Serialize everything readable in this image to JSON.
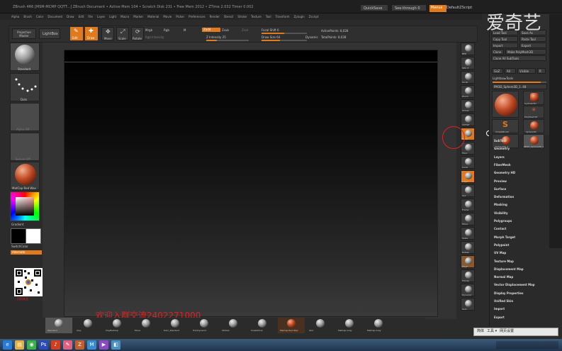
{
  "title_bar": {
    "app_info": "ZBrush 4R6 [MSM-MCMP QQTT...] ZBrush Document • Active Mem 104 • Scratch Disk 231 • Free Mem 2012 • ZTime 2.032 Timer 0.002",
    "quicksave": "QuickSave",
    "see_through": "See-through 0",
    "menus_btn": "Menus",
    "default_script": "DefaultZScript"
  },
  "menubar": {
    "items": [
      "Alpha",
      "Brush",
      "Color",
      "Document",
      "Draw",
      "Edit",
      "File",
      "Layer",
      "Light",
      "Macro",
      "Marker",
      "Material",
      "Movie",
      "Picker",
      "Preferences",
      "Render",
      "Stencil",
      "Stroke",
      "Texture",
      "Tool",
      "Transform",
      "Zplugin",
      "Zscript"
    ]
  },
  "shelf": {
    "projection_master": "Projection Master",
    "lightbox": "LightBox",
    "edit": "Edit",
    "draw": "Draw",
    "move": "Move",
    "scale": "Scale",
    "rotate": "Rotate",
    "mrgb": "Mrgb",
    "rgb": "Rgb",
    "m": "M",
    "rgb_intensity": "Rgb Intensity",
    "zadd": "Zadd",
    "zsub": "Zsub",
    "zcut": "Zcut",
    "z_intensity": "Z Intensity 25",
    "focal_shift": "Focal Shift 0",
    "draw_size": "Draw Size 64",
    "dynamic": "Dynamic",
    "active_points": "ActivePoints: 8,028",
    "total_points": "TotalPoints: 8,028"
  },
  "left_panel": {
    "brush_label": "Standard",
    "stroke_label": "Dots",
    "alpha_label": "Alpha Off",
    "texture_label": "Texture Off",
    "material_label": "MatCap Red Wax",
    "gradient": "Gradient",
    "switch_color": "SwitchColor",
    "alternate": "Alternate"
  },
  "right_shelf": [
    {
      "label": "BPR"
    },
    {
      "label": "SPix 3"
    },
    {
      "label": "Scroll"
    },
    {
      "label": "Zoom"
    },
    {
      "label": "Actual"
    },
    {
      "label": "AAHalf"
    },
    {
      "label": "Persp"
    },
    {
      "label": "Floor"
    },
    {
      "label": "Local"
    },
    {
      "label": "L.Sym"
    },
    {
      "label": "Xyz"
    },
    {
      "label": "Frame"
    },
    {
      "label": "Move"
    },
    {
      "label": "Scale"
    },
    {
      "label": "Rotate"
    },
    {
      "label": "PolyF"
    },
    {
      "label": "Transp"
    },
    {
      "label": "Dynamic"
    },
    {
      "label": "Solo"
    }
  ],
  "tool_panel": {
    "header": "Tool",
    "buttons": [
      "Load Tool",
      "Save As",
      "Copy Tool",
      "Paste Tool",
      "Import",
      "Export",
      "Clone",
      "Make PolyMesh3D",
      "Clone All SubTools"
    ],
    "goz": "GoZ",
    "all": "All",
    "visible": "Visible",
    "r": "R",
    "lightbox_tools": "Lightbox▸Tools",
    "current_tool": "PM3D_Sphere3D_1. 48",
    "tools": [
      {
        "name": "PM3D_Sphere3D_1"
      },
      {
        "name": "Cylinder3D"
      },
      {
        "name": "PolyMesh3D"
      },
      {
        "name": "SimpleBrush"
      },
      {
        "name": "Sphere3D"
      },
      {
        "name": "Sphere3D_1"
      },
      {
        "name": "PM3D_Sphere3D_1"
      }
    ],
    "sections": [
      "SubTool",
      "Geometry",
      "Layers",
      "FiberMesh",
      "Geometry HD",
      "Preview",
      "Surface",
      "Deformation",
      "Masking",
      "Visibility",
      "Polygroups",
      "Contact",
      "Morph Target",
      "Polypaint",
      "UV Map",
      "Texture Map",
      "Displacement Map",
      "Normal Map",
      "Vector Displacement Map",
      "Display Properties",
      "Unified Skin",
      "Import",
      "Export"
    ]
  },
  "watermark": {
    "logo": "爱奇艺",
    "overlay_text": "欢迎入群交流2402271000",
    "qr_caption": "扫码关注"
  },
  "bottom_materials": [
    {
      "name": "Standard"
    },
    {
      "name": "Clay"
    },
    {
      "name": "ClayBuildup"
    },
    {
      "name": "Move"
    },
    {
      "name": "Dam_Standard"
    },
    {
      "name": "TrimDynamic"
    },
    {
      "name": "hPolish"
    },
    {
      "name": "SnakeHook"
    },
    {
      "name": "MatCap Red Wax"
    },
    {
      "name": "Skin"
    },
    {
      "name": "MatCap Gray"
    },
    {
      "name": "MatCap Gray"
    }
  ],
  "ime_bar": {
    "items": [
      "简体",
      "工具 ▾",
      "网页设置"
    ]
  },
  "taskbar": {
    "apps": [
      "ie-icon",
      "folder-icon",
      "chrome-icon",
      "photoshop-icon",
      "winamp-icon",
      "paint-icon",
      "zbrush-icon",
      "3dsmax-icon",
      "media-icon",
      "explorer-icon"
    ]
  },
  "colors": {
    "accent": "#e07a1c",
    "overlay_red": "#e02020",
    "panel": "#2b2b2b",
    "canvas": "#000000"
  }
}
